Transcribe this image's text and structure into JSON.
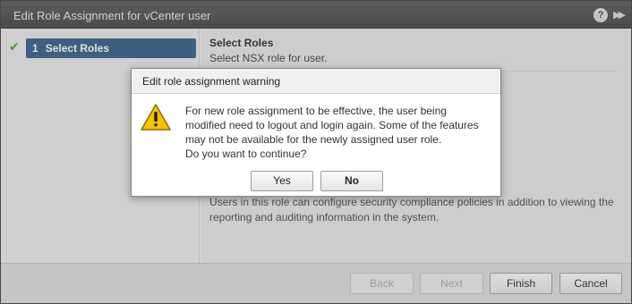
{
  "window": {
    "title": "Edit Role Assignment for vCenter user",
    "help_symbol": "?",
    "expand_symbol": "▶▶"
  },
  "sidebar": {
    "steps": [
      {
        "number": "1",
        "label": "Select Roles",
        "completed": true,
        "active": true
      }
    ]
  },
  "content": {
    "title": "Select Roles",
    "subtitle": "Select NSX role for user.",
    "role_description_line1": "Users in this role can configure security compliance policies in addition to viewing the",
    "role_description_line2": "reporting and auditing information in the system."
  },
  "footer": {
    "back_label": "Back",
    "next_label": "Next",
    "finish_label": "Finish",
    "cancel_label": "Cancel"
  },
  "dialog": {
    "title": "Edit role assignment warning",
    "message_lines": [
      "For new role assignment to be effective, the user being",
      "modified need to logout and login again. Some of the features",
      "may not be available for the newly assigned user role.",
      "Do you want to continue?"
    ],
    "yes_label": "Yes",
    "no_label": "No",
    "icon": "warning-triangle-icon"
  },
  "colors": {
    "titlebar": "#4a4a4a",
    "step_active": "#2d5a86",
    "check": "#4b9a2a",
    "warning_yellow": "#f5c400"
  }
}
